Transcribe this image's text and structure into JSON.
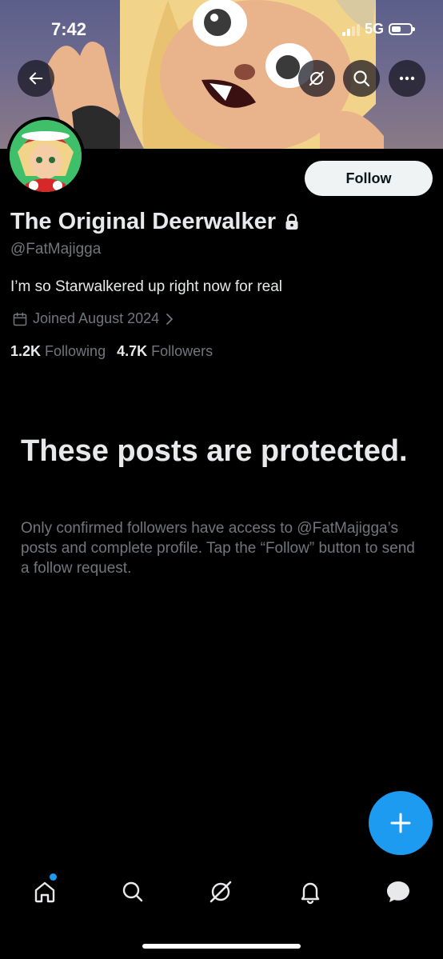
{
  "status_bar": {
    "time": "7:42",
    "network": "5G"
  },
  "header": {
    "back_icon": "arrow-left-icon",
    "grok_icon": "grok-icon",
    "search_icon": "search-icon",
    "more_icon": "more-icon"
  },
  "profile": {
    "follow_label": "Follow",
    "display_name": "The Original Deerwalker",
    "handle": "@FatMajigga",
    "bio": "I’m so Starwalkered up right now for real",
    "joined": "Joined August 2024",
    "following_count": "1.2K",
    "following_label": "Following",
    "followers_count": "4.7K",
    "followers_label": "Followers"
  },
  "protected": {
    "title": "These posts are protected.",
    "body": "Only confirmed followers have access to @FatMajigga’s posts and complete profile. Tap the “Follow” button to send a follow request."
  },
  "colors": {
    "accent": "#1d9bf0",
    "muted": "#71767b",
    "text": "#e7e9ea"
  },
  "tabbar": {
    "items": [
      "home-icon",
      "search-icon",
      "grok-icon",
      "notifications-icon",
      "messages-icon"
    ]
  }
}
